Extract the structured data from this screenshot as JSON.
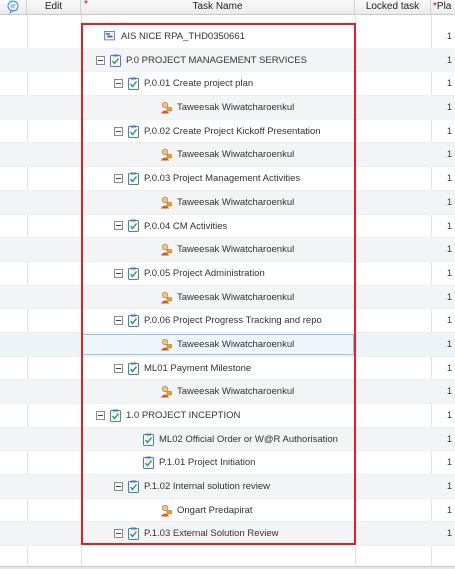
{
  "header": {
    "edit": "Edit",
    "task_name": "Task Name",
    "locked_task": "Locked task",
    "plan": "Pla",
    "required_mark": "*"
  },
  "rows": [
    {
      "label": "AIS NICE RPA_THD0350661",
      "type": "project",
      "plan": "1"
    },
    {
      "label": "P.0 PROJECT MANAGEMENT SERVICES",
      "type": "summary",
      "plan": "1"
    },
    {
      "label": "P.0.01 Create project plan",
      "type": "summary",
      "plan": "1"
    },
    {
      "label": "Taweesak Wiwatcharoenkul",
      "type": "resource",
      "plan": "1"
    },
    {
      "label": "P.0.02 Create Project Kickoff Presentation",
      "type": "summary",
      "plan": "1"
    },
    {
      "label": "Taweesak Wiwatcharoenkul",
      "type": "resource",
      "plan": "1"
    },
    {
      "label": "P.0.03 Project Management Activities",
      "type": "summary",
      "plan": "1"
    },
    {
      "label": "Taweesak Wiwatcharoenkul",
      "type": "resource",
      "plan": "1"
    },
    {
      "label": "P.0.04 CM Activities",
      "type": "summary",
      "plan": "1"
    },
    {
      "label": "Taweesak Wiwatcharoenkul",
      "type": "resource",
      "plan": "1"
    },
    {
      "label": "P.0.05 Project Administration",
      "type": "summary",
      "plan": "1"
    },
    {
      "label": "Taweesak Wiwatcharoenkul",
      "type": "resource",
      "plan": "1"
    },
    {
      "label": "P.0.06 Project Progress Tracking and repo",
      "type": "summary",
      "plan": "1"
    },
    {
      "label": "Taweesak Wiwatcharoenkul",
      "type": "resource",
      "plan": "1",
      "selected": true
    },
    {
      "label": "ML01 Payment Milestone",
      "type": "summary",
      "plan": "1"
    },
    {
      "label": "Taweesak Wiwatcharoenkul",
      "type": "resource",
      "plan": "1"
    },
    {
      "label": "1.0 PROJECT INCEPTION",
      "type": "summary",
      "plan": "1"
    },
    {
      "label": "ML02 Official Order or W@R Authorisation",
      "type": "task",
      "plan": "1"
    },
    {
      "label": "P.1.01 Project Initiation",
      "type": "task",
      "plan": "1"
    },
    {
      "label": "P.1.02 Internal solution review",
      "type": "summary",
      "plan": "1"
    },
    {
      "label": "Ongart Predapirat",
      "type": "resource",
      "plan": "1"
    },
    {
      "label": "P.1.03 External Solution Review",
      "type": "summary",
      "plan": "1"
    }
  ],
  "colors": {
    "highlight_frame": "#e0202a",
    "selection": "#9ac3d6"
  }
}
